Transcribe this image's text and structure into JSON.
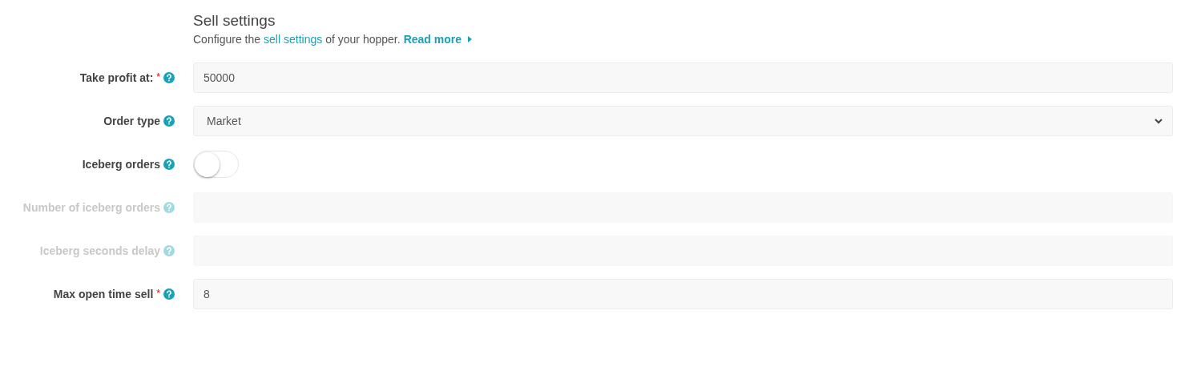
{
  "section": {
    "title": "Sell settings",
    "description": {
      "before": "Configure the",
      "link": "sell settings",
      "after": "of your hopper.",
      "read_more": "Read more"
    }
  },
  "fields": [
    {
      "kind": "text",
      "label": "Take profit at:",
      "required_mark": "*",
      "disabled": false,
      "value": "50000"
    },
    {
      "kind": "select",
      "label": "Order type",
      "disabled": false,
      "value": "Market"
    },
    {
      "kind": "toggle",
      "label": "Iceberg orders",
      "disabled": false,
      "on": false
    },
    {
      "kind": "text",
      "label": "Number of iceberg orders",
      "disabled": true
    },
    {
      "kind": "text",
      "label": "Iceberg seconds delay",
      "disabled": true
    },
    {
      "kind": "text",
      "label": "Max open time sell",
      "required_mark": "*",
      "disabled": false,
      "value": "8"
    }
  ]
}
